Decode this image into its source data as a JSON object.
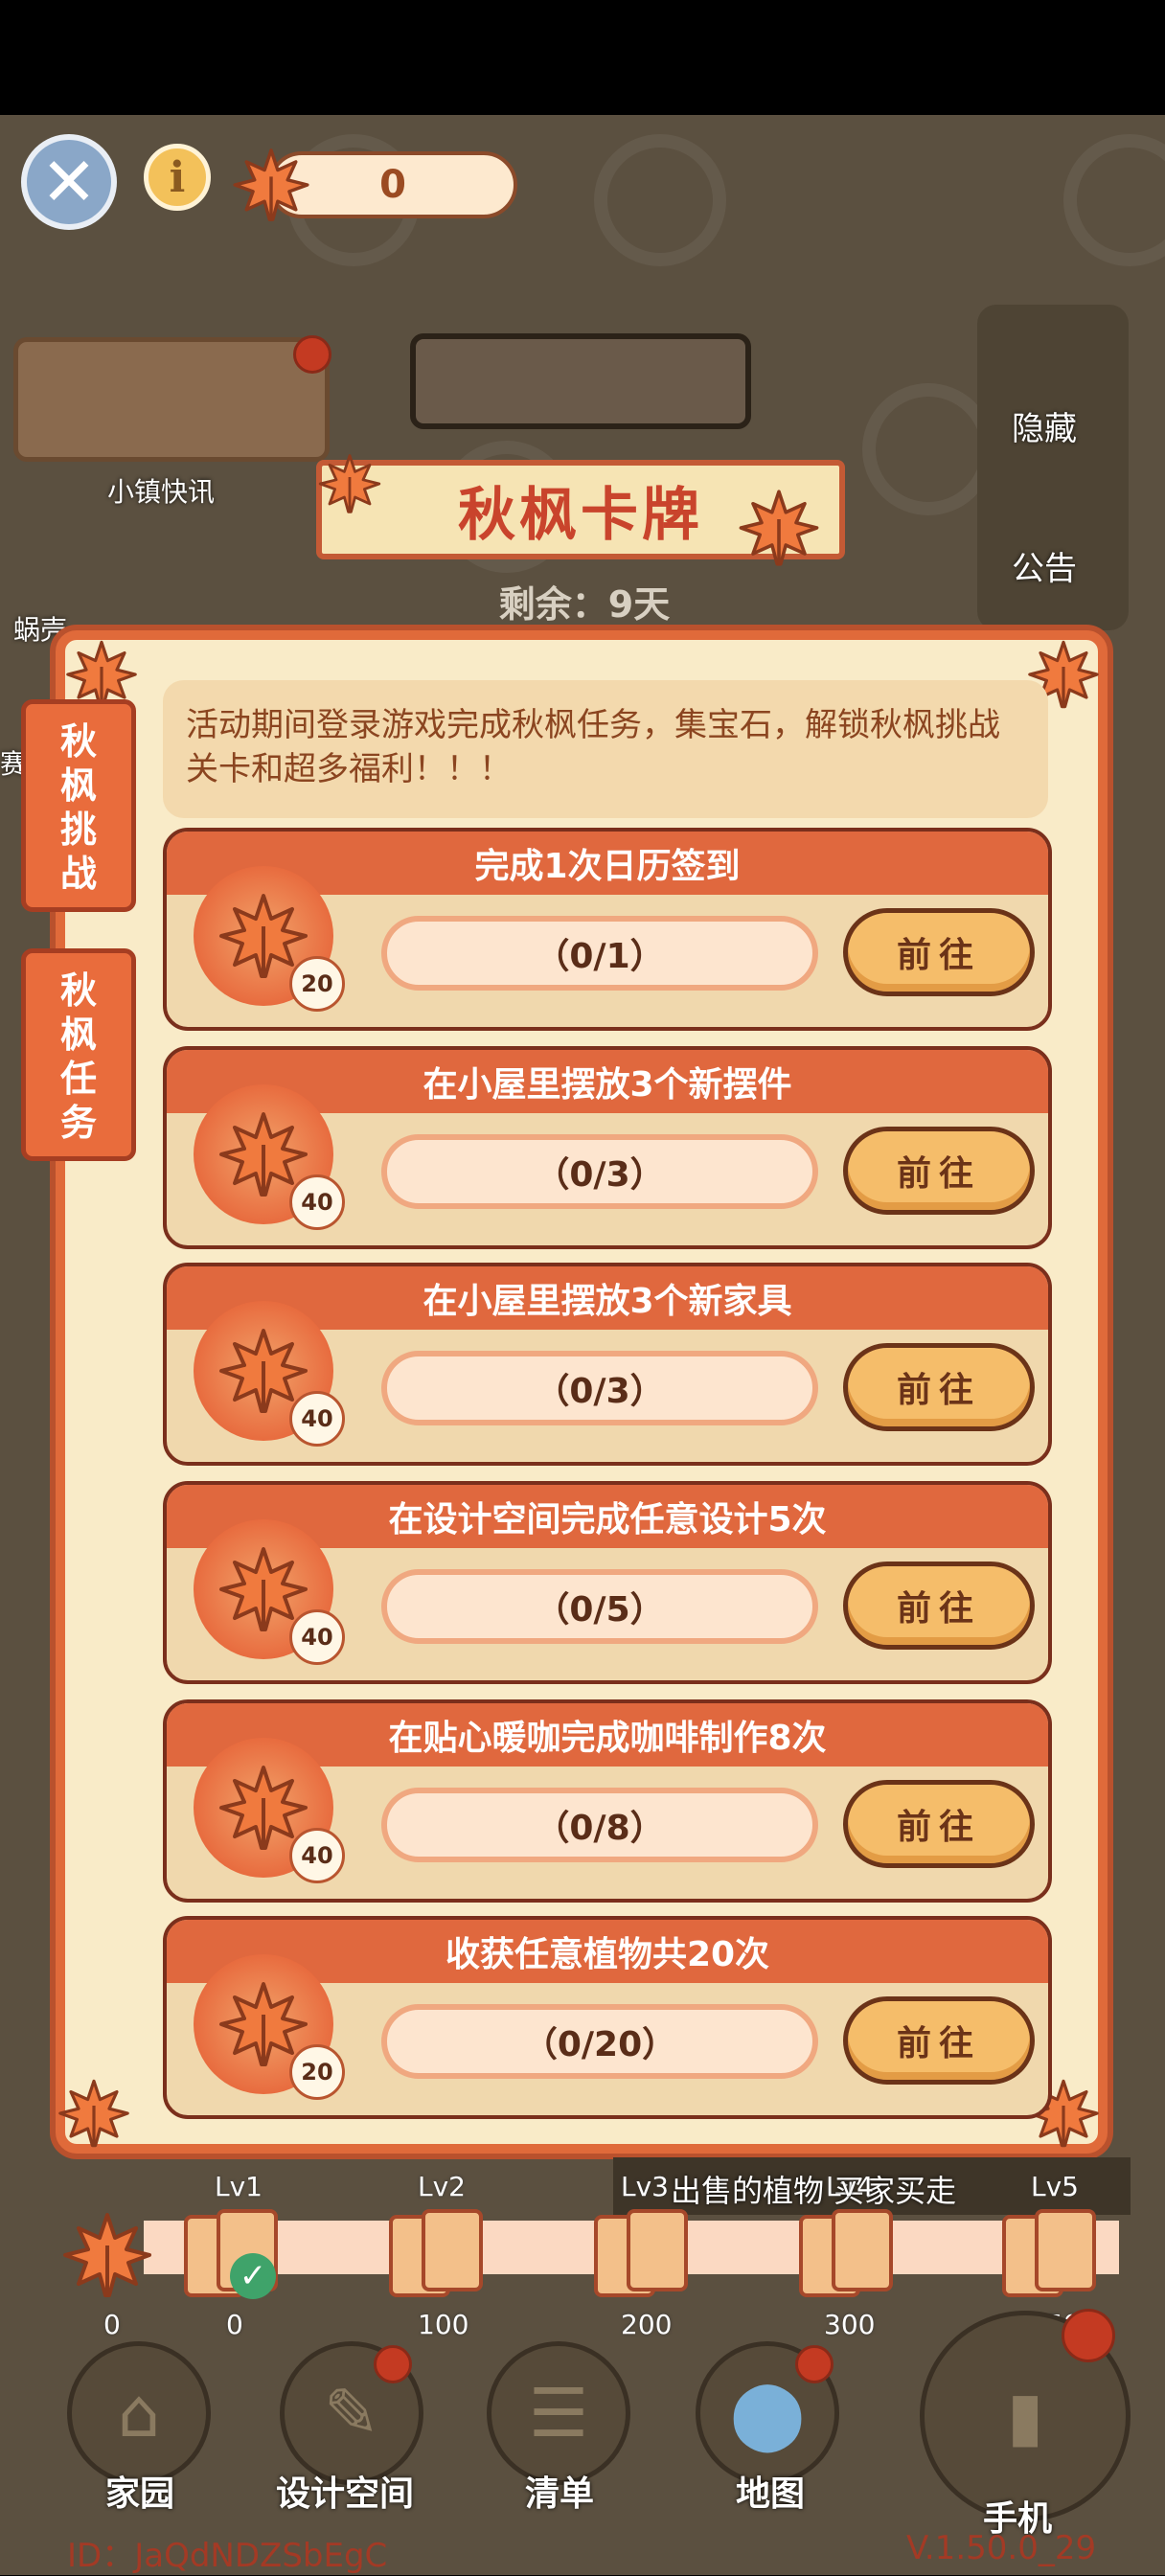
{
  "header": {
    "currency_value": "0",
    "close_icon": "close-icon",
    "info_icon": "info-icon",
    "leaf_icon": "maple-leaf-icon"
  },
  "background": {
    "news_label": "小镇快讯",
    "hide_label": "隐藏",
    "notice_label": "公告",
    "left_partial_label": "蜗壳",
    "left_partial_label2": "赛",
    "marquee_text": "出售的植物 买家买走"
  },
  "event": {
    "title": "秋枫卡牌",
    "remaining": "剩余：9天"
  },
  "side_tabs": [
    {
      "label": "秋枫挑战"
    },
    {
      "label": "秋枫任务"
    }
  ],
  "description": "活动期间登录游戏完成秋枫任务，集宝石，解锁秋枫挑战关卡和超多福利！！！",
  "tasks": [
    {
      "title": "完成1次日历签到",
      "reward": "20",
      "progress": "（0/1）",
      "button": "前往"
    },
    {
      "title": "在小屋里摆放3个新摆件",
      "reward": "40",
      "progress": "（0/3）",
      "button": "前往"
    },
    {
      "title": "在小屋里摆放3个新家具",
      "reward": "40",
      "progress": "（0/3）",
      "button": "前往"
    },
    {
      "title": "在设计空间完成任意设计5次",
      "reward": "40",
      "progress": "（0/5）",
      "button": "前往"
    },
    {
      "title": "在贴心暖咖完成咖啡制作8次",
      "reward": "40",
      "progress": "（0/8）",
      "button": "前往"
    },
    {
      "title": "收获任意植物共20次",
      "reward": "20",
      "progress": "（0/20）",
      "button": "前往"
    }
  ],
  "levels": {
    "start_value": "0",
    "items": [
      {
        "label": "Lv1",
        "value": "0"
      },
      {
        "label": "Lv2",
        "value": "100"
      },
      {
        "label": "Lv3",
        "value": "200"
      },
      {
        "label": "Lv4",
        "value": "300"
      },
      {
        "label": "Lv5",
        "value": "450"
      }
    ]
  },
  "nav": [
    {
      "label": "家园",
      "icon": "home-icon"
    },
    {
      "label": "设计空间",
      "icon": "design-icon"
    },
    {
      "label": "清单",
      "icon": "list-icon"
    },
    {
      "label": "地图",
      "icon": "map-pin-icon"
    },
    {
      "label": "手机",
      "icon": "phone-icon"
    }
  ],
  "footer": {
    "id_text": "ID：JaQdNDZSbEgC",
    "version": "V.1.50.0_29"
  },
  "colors": {
    "accent": "#e0683e",
    "panel": "#f9ebc8",
    "title_text": "#c9442c"
  }
}
